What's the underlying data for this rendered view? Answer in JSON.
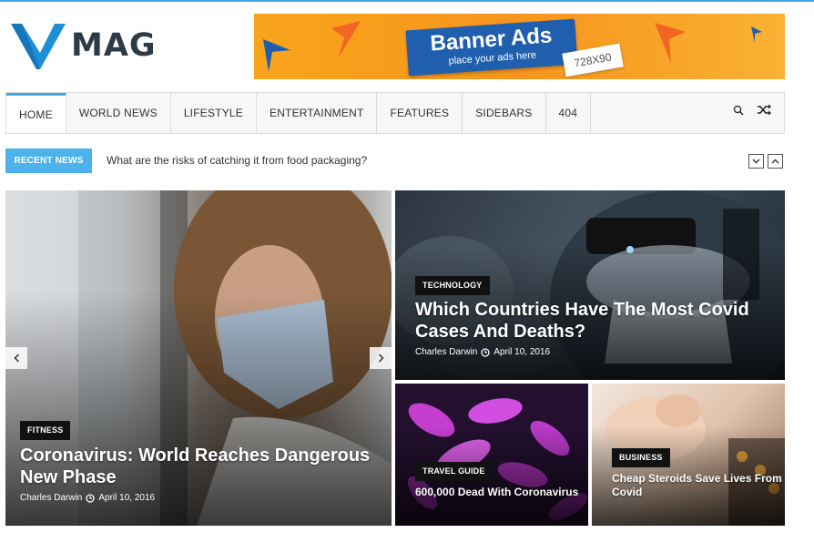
{
  "site": {
    "logo_text": "MAG"
  },
  "banner": {
    "title": "Banner Ads",
    "subtitle": "place your ads here",
    "size": "728X90"
  },
  "nav": {
    "items": [
      "HOME",
      "WORLD NEWS",
      "LIFESTYLE",
      "ENTERTAINMENT",
      "FEATURES",
      "SIDEBARS",
      "404"
    ],
    "search_icon": "search-icon",
    "random_icon": "shuffle-icon"
  },
  "ticker": {
    "label": "RECENT NEWS",
    "text": "What are the risks of catching it from food packaging?"
  },
  "posts": [
    {
      "category": "FITNESS",
      "title": "Coronavirus: World Reaches Dangerous New Phase",
      "author": "Charles Darwin",
      "date": "April 10, 2016"
    },
    {
      "category": "TECHNOLOGY",
      "title": "Which Countries Have The Most Covid Cases And Deaths?",
      "author": "Charles Darwin",
      "date": "April 10, 2016"
    },
    {
      "category": "TRAVEL GUIDE",
      "title": "600,000 Dead With Coronavirus"
    },
    {
      "category": "BUSINESS",
      "title": "Cheap Steroids Save Lives From Covid"
    }
  ],
  "colors": {
    "accent": "#3fa9e5",
    "ticker": "#4db2ec",
    "logo_dark": "#2e3a45"
  }
}
